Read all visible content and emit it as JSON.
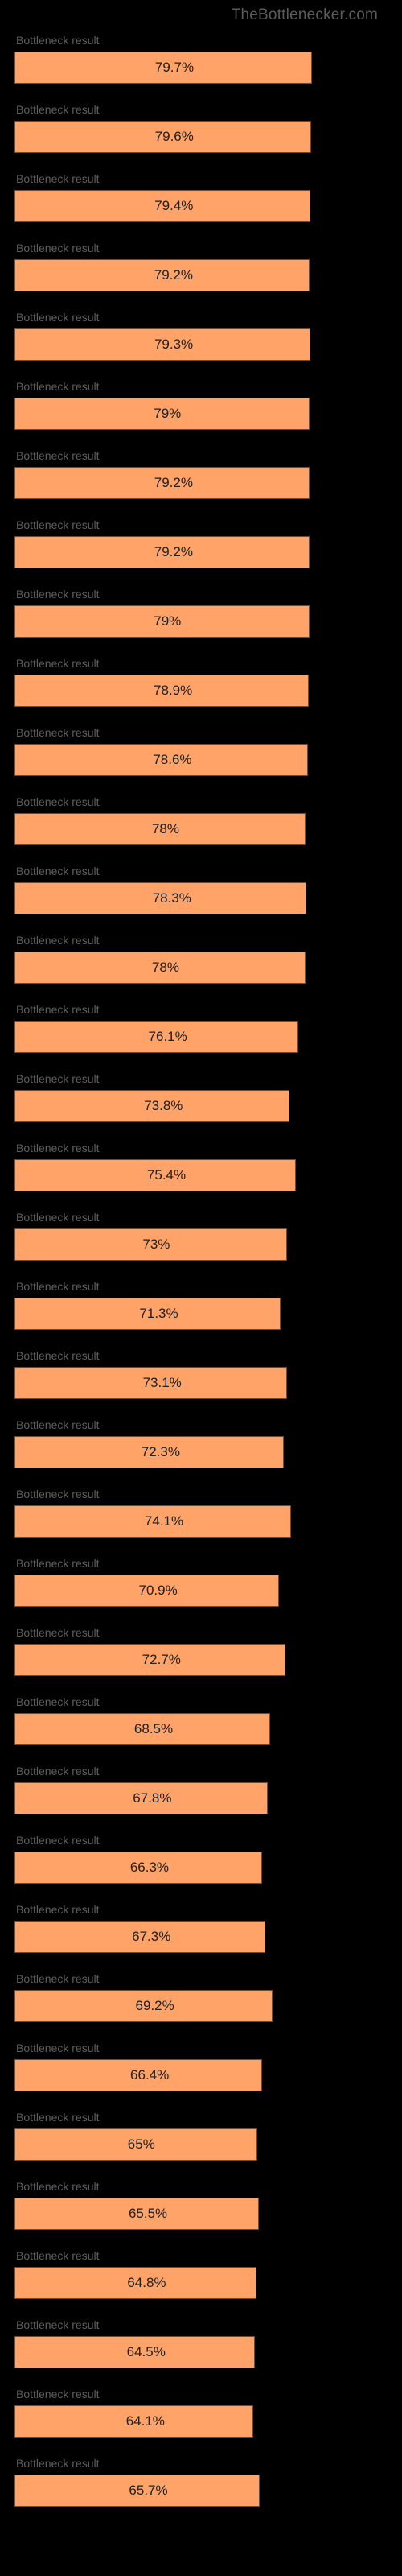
{
  "header": {
    "site": "TheBottlenecker.com",
    "link_name": "site-link"
  },
  "chart_data": {
    "type": "bar",
    "title": "",
    "xlabel": "",
    "ylabel": "",
    "xlim": [
      0,
      100
    ],
    "bar_color": "#ffa368",
    "categories": [
      "Bottleneck result",
      "Bottleneck result",
      "Bottleneck result",
      "Bottleneck result",
      "Bottleneck result",
      "Bottleneck result",
      "Bottleneck result",
      "Bottleneck result",
      "Bottleneck result",
      "Bottleneck result",
      "Bottleneck result",
      "Bottleneck result",
      "Bottleneck result",
      "Bottleneck result",
      "Bottleneck result",
      "Bottleneck result",
      "Bottleneck result",
      "Bottleneck result",
      "Bottleneck result",
      "Bottleneck result",
      "Bottleneck result",
      "Bottleneck result",
      "Bottleneck result",
      "Bottleneck result",
      "Bottleneck result",
      "Bottleneck result",
      "Bottleneck result",
      "Bottleneck result",
      "Bottleneck result",
      "Bottleneck result",
      "Bottleneck result",
      "Bottleneck result",
      "Bottleneck result",
      "Bottleneck result",
      "Bottleneck result",
      "Bottleneck result"
    ],
    "values": [
      79.7,
      79.6,
      79.4,
      79.2,
      79.3,
      79.0,
      79.2,
      79.2,
      79.0,
      78.9,
      78.6,
      78.0,
      78.3,
      78.0,
      76.1,
      73.8,
      75.4,
      73.0,
      71.3,
      73.1,
      72.3,
      74.1,
      70.9,
      72.7,
      68.5,
      67.8,
      66.3,
      67.3,
      69.2,
      66.4,
      65.0,
      65.5,
      64.8,
      64.5,
      64.1,
      65.7
    ],
    "value_labels": [
      "79.7%",
      "79.6%",
      "79.4%",
      "79.2%",
      "79.3%",
      "79%",
      "79.2%",
      "79.2%",
      "79%",
      "78.9%",
      "78.6%",
      "78%",
      "78.3%",
      "78%",
      "76.1%",
      "73.8%",
      "75.4%",
      "73%",
      "71.3%",
      "73.1%",
      "72.3%",
      "74.1%",
      "70.9%",
      "72.7%",
      "68.5%",
      "67.8%",
      "66.3%",
      "67.3%",
      "69.2%",
      "66.4%",
      "65%",
      "65.5%",
      "64.8%",
      "64.5%",
      "64.1%",
      "65.7%"
    ]
  }
}
